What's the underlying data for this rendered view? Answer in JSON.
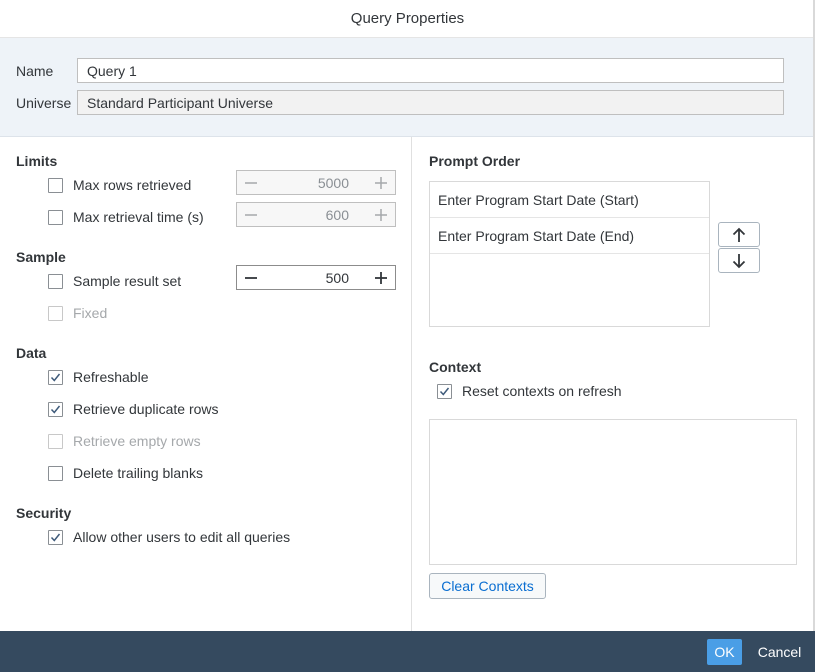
{
  "dialog": {
    "title": "Query Properties"
  },
  "header": {
    "name_label": "Name",
    "name_value": "Query 1",
    "universe_label": "Universe",
    "universe_value": "Standard Participant Universe"
  },
  "limits": {
    "title": "Limits",
    "max_rows": {
      "label": "Max rows retrieved",
      "checked": false,
      "value": "5000"
    },
    "max_time": {
      "label": "Max retrieval time (s)",
      "checked": false,
      "value": "600"
    }
  },
  "sample": {
    "title": "Sample",
    "result_set": {
      "label": "Sample result set",
      "checked": false,
      "value": "500"
    },
    "fixed": {
      "label": "Fixed",
      "checked": false,
      "disabled": true
    }
  },
  "data": {
    "title": "Data",
    "refreshable": {
      "label": "Refreshable",
      "checked": true
    },
    "duplicate_rows": {
      "label": "Retrieve duplicate rows",
      "checked": true
    },
    "empty_rows": {
      "label": "Retrieve empty rows",
      "checked": false,
      "disabled": true
    },
    "trailing_blanks": {
      "label": "Delete trailing blanks",
      "checked": false
    }
  },
  "security": {
    "title": "Security",
    "allow_edit": {
      "label": "Allow other users to edit all queries",
      "checked": true
    }
  },
  "prompt_order": {
    "title": "Prompt Order",
    "items": [
      "Enter Program Start Date (Start)",
      "Enter Program Start Date (End)"
    ],
    "up_icon": "arrow-up-icon",
    "down_icon": "arrow-down-icon"
  },
  "context": {
    "title": "Context",
    "reset": {
      "label": "Reset contexts on refresh",
      "checked": true
    },
    "clear_label": "Clear Contexts"
  },
  "footer": {
    "ok_label": "OK",
    "cancel_label": "Cancel"
  },
  "colors": {
    "accent": "#0a6ed1",
    "footer_bg": "#354a5f",
    "ok_bg": "#4a9ee6",
    "header_bg": "#eef3f8"
  }
}
